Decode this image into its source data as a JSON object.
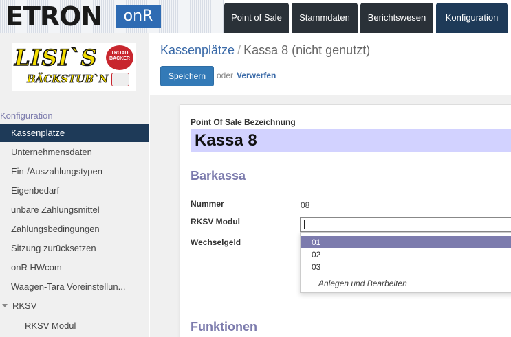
{
  "header": {
    "brand_main": "ETRON",
    "brand_badge": "onR",
    "tabs": [
      {
        "label": "Point of Sale"
      },
      {
        "label": "Stammdaten"
      },
      {
        "label": "Berichtswesen"
      },
      {
        "label": "Konfiguration"
      }
    ]
  },
  "sidebar": {
    "company_logo_text": "LISI`S",
    "company_logo_sub": "BÄCKSTUB`N",
    "seal_text": "TROAD BACKER",
    "section": "Konfiguration",
    "items": [
      {
        "label": "Kassenplätze"
      },
      {
        "label": "Unternehmensdaten"
      },
      {
        "label": "Ein-/Auszahlungstypen"
      },
      {
        "label": "Eigenbedarf"
      },
      {
        "label": "unbare Zahlungsmittel"
      },
      {
        "label": "Zahlungsbedingungen"
      },
      {
        "label": "Sitzung zurücksetzen"
      },
      {
        "label": "onR HWcom"
      },
      {
        "label": "Waagen-Tara Voreinstellun..."
      },
      {
        "label": "RKSV"
      },
      {
        "label": "RKSV Modul"
      }
    ]
  },
  "breadcrumb": {
    "parent": "Kassenplätze",
    "separator": "/",
    "current": "Kassa 8 (nicht genutzt)"
  },
  "toolbar": {
    "save_label": "Speichern",
    "or_label": "oder",
    "discard_label": "Verwerfen"
  },
  "form": {
    "name_label": "Point Of Sale Bezeichnung",
    "name_value": "Kassa 8",
    "group_barkassa": "Barkassa",
    "nummer_label": "Nummer",
    "nummer_value": "08",
    "rksv_label": "RKSV Modul",
    "rksv_value": "",
    "wechselgeld_label": "Wechselgeld",
    "group_funktionen": "Funktionen"
  },
  "dropdown": {
    "options": [
      "01",
      "02",
      "03"
    ],
    "highlighted": "01",
    "create_label": "Anlegen und Bearbeiten"
  },
  "colors": {
    "nav_dark": "#2a3138",
    "nav_active": "#1e3a58",
    "accent": "#7c7bad",
    "primary": "#337ab7",
    "name_bg": "#d2d2ff"
  }
}
